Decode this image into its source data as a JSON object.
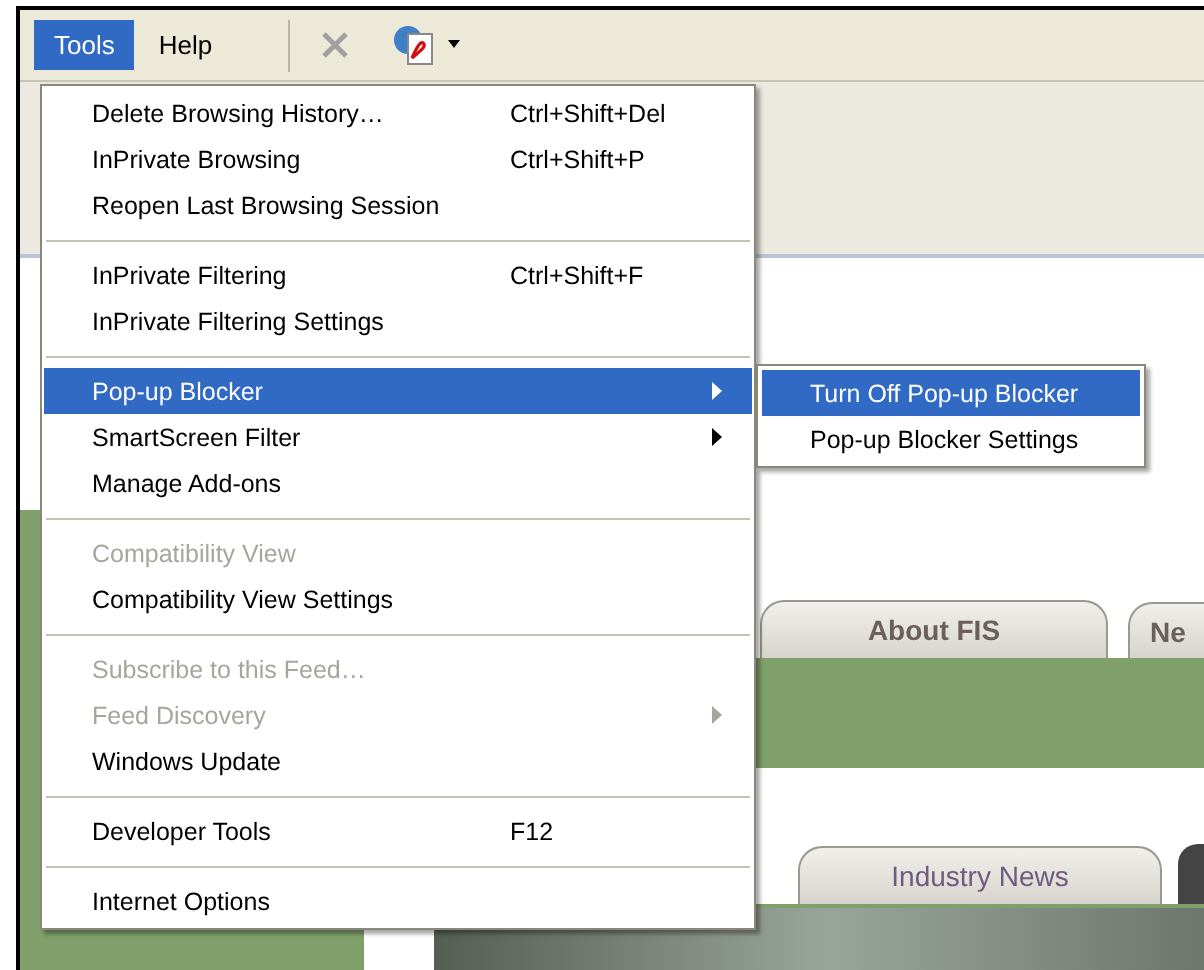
{
  "menu_bar": [
    {
      "label": "Tools",
      "selected": true
    },
    {
      "label": "Help",
      "selected": false
    }
  ],
  "tools_menu": [
    {
      "kind": "item",
      "label": "Delete Browsing History…",
      "shortcut": "Ctrl+Shift+Del",
      "submenu": false,
      "disabled": false,
      "selected": false
    },
    {
      "kind": "item",
      "label": "InPrivate Browsing",
      "shortcut": "Ctrl+Shift+P",
      "submenu": false,
      "disabled": false,
      "selected": false
    },
    {
      "kind": "item",
      "label": "Reopen Last Browsing Session",
      "submenu": false,
      "disabled": false,
      "selected": false
    },
    {
      "kind": "separator"
    },
    {
      "kind": "item",
      "label": "InPrivate Filtering",
      "shortcut": "Ctrl+Shift+F",
      "submenu": false,
      "disabled": false,
      "selected": false
    },
    {
      "kind": "item",
      "label": "InPrivate Filtering Settings",
      "submenu": false,
      "disabled": false,
      "selected": false
    },
    {
      "kind": "separator"
    },
    {
      "kind": "item",
      "label": "Pop-up Blocker",
      "submenu": true,
      "disabled": false,
      "selected": true
    },
    {
      "kind": "item",
      "label": "SmartScreen Filter",
      "submenu": true,
      "disabled": false,
      "selected": false
    },
    {
      "kind": "item",
      "label": "Manage Add-ons",
      "submenu": false,
      "disabled": false,
      "selected": false
    },
    {
      "kind": "separator"
    },
    {
      "kind": "item",
      "label": "Compatibility View",
      "submenu": false,
      "disabled": true,
      "selected": false
    },
    {
      "kind": "item",
      "label": "Compatibility View Settings",
      "submenu": false,
      "disabled": false,
      "selected": false
    },
    {
      "kind": "separator"
    },
    {
      "kind": "item",
      "label": "Subscribe to this Feed…",
      "submenu": false,
      "disabled": true,
      "selected": false
    },
    {
      "kind": "item",
      "label": "Feed Discovery",
      "submenu": true,
      "disabled": true,
      "selected": false
    },
    {
      "kind": "item",
      "label": "Windows Update",
      "submenu": false,
      "disabled": false,
      "selected": false
    },
    {
      "kind": "separator"
    },
    {
      "kind": "item",
      "label": "Developer Tools",
      "shortcut": "F12",
      "submenu": false,
      "disabled": false,
      "selected": false
    },
    {
      "kind": "separator"
    },
    {
      "kind": "item",
      "label": "Internet Options",
      "submenu": false,
      "disabled": false,
      "selected": false
    }
  ],
  "popup_blocker_submenu": [
    {
      "label": "Turn Off Pop-up Blocker",
      "selected": true
    },
    {
      "label": "Pop-up Blocker Settings",
      "selected": false
    }
  ],
  "page_tabs_top": [
    {
      "label": "About FIS"
    },
    {
      "label": "Ne"
    }
  ],
  "page_tabs_bottom": [
    {
      "label": "Industry News"
    }
  ]
}
